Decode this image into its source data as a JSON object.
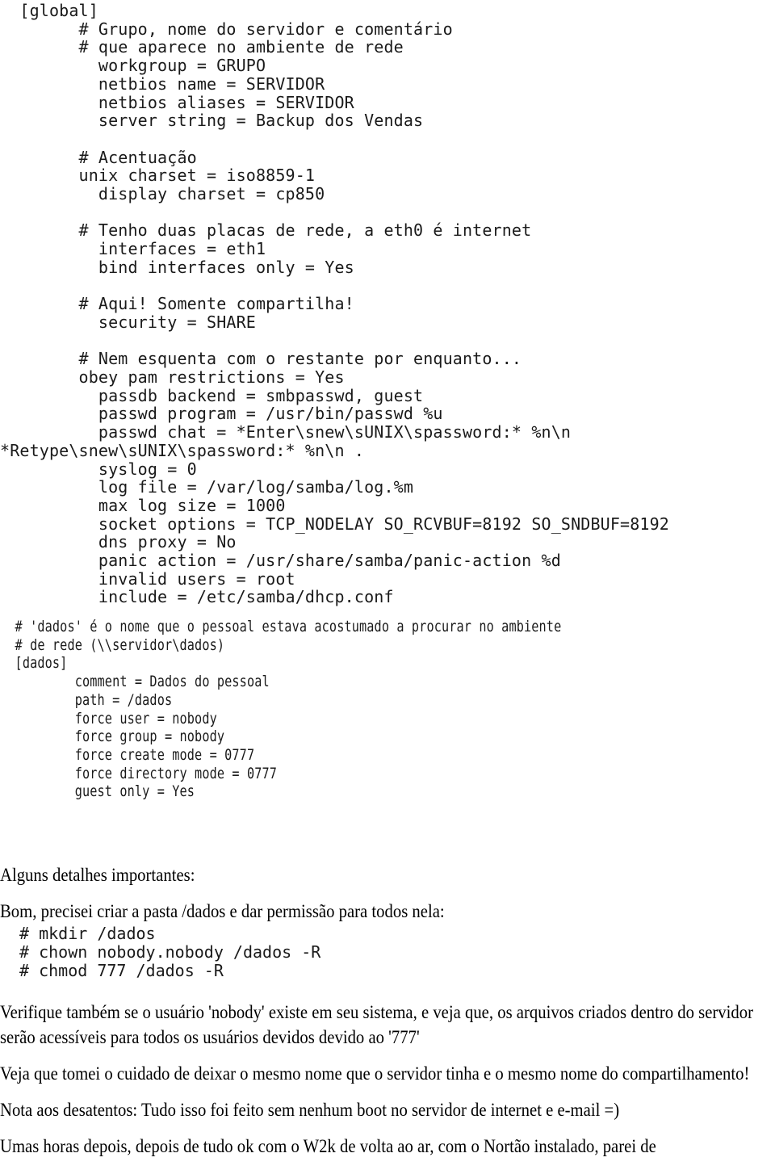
{
  "document": {
    "type": "samba-smb-conf-tutorial",
    "background_color": "#ffffff",
    "text_color": "#000000",
    "code_color": "#1a1a1a"
  },
  "config_global": {
    "lines": [
      "  [global]",
      "        # Grupo, nome do servidor e comentário",
      "        # que aparece no ambiente de rede",
      "          workgroup = GRUPO",
      "          netbios name = SERVIDOR",
      "          netbios aliases = SERVIDOR",
      "          server string = Backup dos Vendas",
      "",
      "        # Acentuação",
      "        unix charset = iso8859-1",
      "          display charset = cp850",
      "",
      "        # Tenho duas placas de rede, a eth0 é internet",
      "          interfaces = eth1",
      "          bind interfaces only = Yes",
      "",
      "        # Aqui! Somente compartilha!",
      "          security = SHARE",
      "",
      "        # Nem esquenta com o restante por enquanto...",
      "        obey pam restrictions = Yes",
      "          passdb backend = smbpasswd, guest",
      "          passwd program = /usr/bin/passwd %u",
      "          passwd chat = *Enter\\snew\\sUNIX\\spassword:* %n\\n",
      "*Retype\\snew\\sUNIX\\spassword:* %n\\n .",
      "          syslog = 0",
      "          log file = /var/log/samba/log.%m",
      "          max log size = 1000",
      "          socket options = TCP_NODELAY SO_RCVBUF=8192 SO_SNDBUF=8192",
      "          dns proxy = No",
      "          panic action = /usr/share/samba/panic-action %d",
      "          invalid users = root",
      "          include = /etc/samba/dhcp.conf"
    ]
  },
  "config_dados": {
    "lines": [
      "  # 'dados' é o nome que o pessoal estava acostumado a procurar no ambiente",
      "  # de rede (\\\\servidor\\dados)",
      "  [dados]",
      "          comment = Dados do pessoal",
      "          path = /dados",
      "          force user = nobody",
      "          force group = nobody",
      "          force create mode = 0777",
      "          force directory mode = 0777",
      "          guest only = Yes"
    ]
  },
  "prose_top": {
    "paragraphs": [
      "Alguns detalhes importantes:",
      "Bom, precisei criar a pasta /dados e dar permissão para todos nela:"
    ]
  },
  "commands": {
    "lines": [
      "# mkdir /dados",
      "# chown nobody.nobody /dados -R",
      "# chmod 777 /dados -R"
    ]
  },
  "prose_bottom": {
    "paragraphs": [
      "Verifique também se o usuário 'nobody' existe em seu sistema, e veja que, os arquivos criados dentro do servidor serão acessíveis para todos os usuários devidos devido ao '777'",
      "Veja que tomei o cuidado de deixar o mesmo nome que o servidor tinha e o mesmo nome do compartilhamento!",
      "Nota aos desatentos: Tudo isso foi feito sem nenhum boot no servidor de internet e e-mail =)",
      "Umas horas depois, depois de tudo ok com o W2k de volta ao ar, com o Nortão instalado, parei de"
    ]
  }
}
